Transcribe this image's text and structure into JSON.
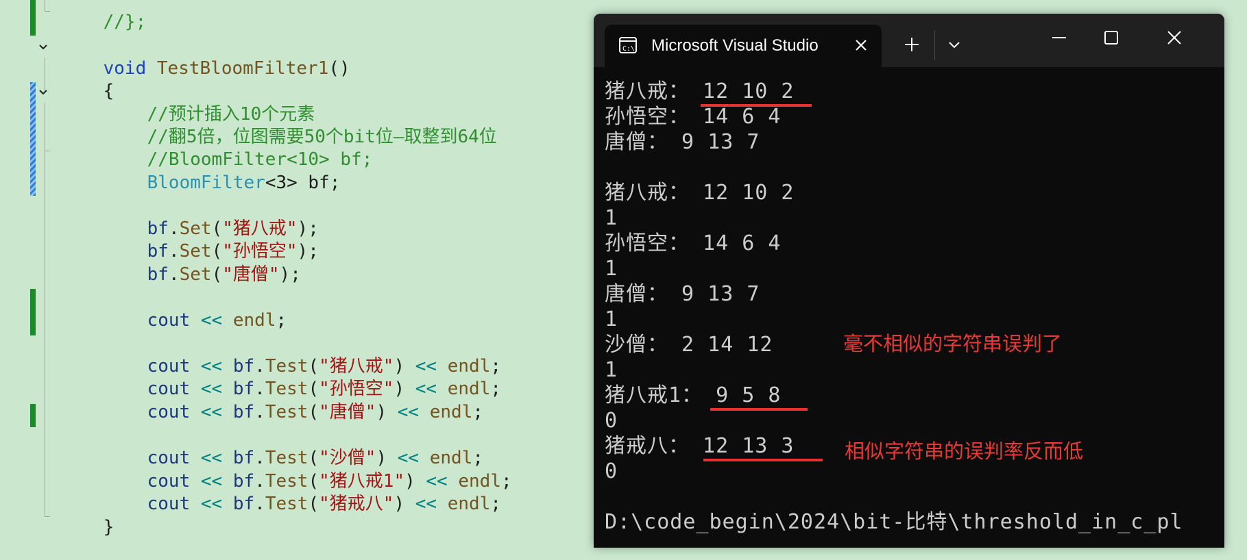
{
  "editor": {
    "top_fragment": "//};",
    "lines": [
      {
        "id": "sig",
        "text": "void TestBloomFilter1()"
      },
      {
        "id": "open",
        "text": "{"
      },
      {
        "id": "c1",
        "text": "//预计插入10个元素"
      },
      {
        "id": "c2",
        "text": "//翻5倍，位图需要50个bit位—取整到64位"
      },
      {
        "id": "c3",
        "text": "//BloomFilter<10> bf;"
      },
      {
        "id": "decl_type",
        "text": "BloomFilter"
      },
      {
        "id": "decl_rest",
        "text": "<3> bf;"
      },
      {
        "id": "set1",
        "text": "猪八戒"
      },
      {
        "id": "set2",
        "text": "孙悟空"
      },
      {
        "id": "set3",
        "text": "唐僧"
      },
      {
        "id": "test1",
        "text": "猪八戒"
      },
      {
        "id": "test2",
        "text": "孙悟空"
      },
      {
        "id": "test3",
        "text": "唐僧"
      },
      {
        "id": "test4",
        "text": "沙僧"
      },
      {
        "id": "test5",
        "text": "猪八戒1"
      },
      {
        "id": "test6",
        "text": "猪戒八"
      },
      {
        "id": "close",
        "text": "}"
      }
    ],
    "tokens": {
      "void": "void",
      "fname": "TestBloomFilter1",
      "parens": "()",
      "bf": "bf",
      "dot": ".",
      "set": "Set",
      "test": "Test",
      "cout": "cout",
      "shift": "<<",
      "endl": "endl",
      "semi": ";",
      "lparen": "(",
      "rparen": ")",
      "quote": "\""
    }
  },
  "terminal": {
    "tab_title": "Microsoft Visual Studio",
    "icon": "console-icon",
    "output": [
      "猪八戒： 12 10 2",
      "孙悟空： 14 6 4",
      "唐僧： 9 13 7",
      "",
      "猪八戒： 12 10 2",
      "1",
      "孙悟空： 14 6 4",
      "1",
      "唐僧： 9 13 7",
      "1",
      "沙僧： 2 14 12",
      "1",
      "猪八戒1： 9 5 8",
      "0",
      "猪戒八： 12 13 3",
      "0",
      "",
      "D:\\code_begin\\2024\\bit-比特\\threshold_in_c_pl"
    ],
    "annotations": {
      "note1": "毫不相似的字符串误判了",
      "note2": "相似字符串的误判率反而低"
    }
  },
  "colors": {
    "editor_bg": "#cbe8cf",
    "terminal_bg": "#0c0c0c",
    "annotation": "#e83a35"
  }
}
